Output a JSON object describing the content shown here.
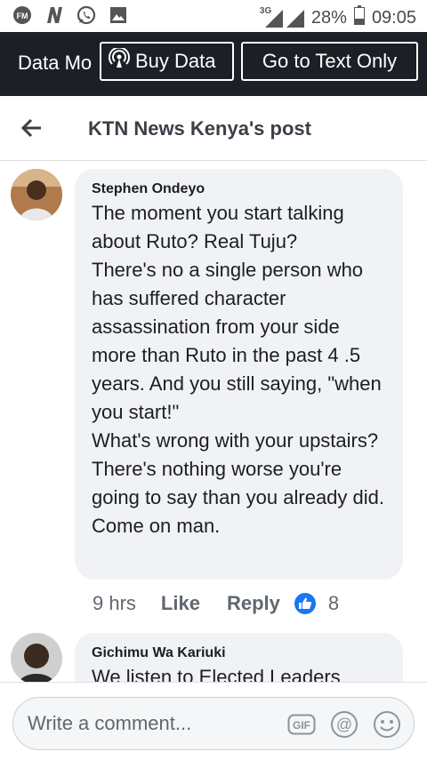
{
  "status_bar": {
    "icons": [
      "fm-radio-icon",
      "n-app-icon",
      "whatsapp-icon",
      "gallery-icon"
    ],
    "network": "3G",
    "battery": "28%",
    "time": "09:05"
  },
  "banner": {
    "data_mode_label": "Data Mo",
    "buy_data_label": "Buy Data",
    "text_only_label": "Go to Text Only"
  },
  "header": {
    "title": "KTN News Kenya's post"
  },
  "comments": [
    {
      "author": "Stephen Ondeyo",
      "text": "The moment you start talking about Ruto? Real Tuju?\nThere's no a single person who has suffered character assassination from your side more than Ruto in the past 4 .5 years. And you still saying, \"when you start!\"\nWhat's wrong with your upstairs?\nThere's nothing worse you're going to say than you already did. Come on man.",
      "time": "9 hrs",
      "like_label": "Like",
      "reply_label": "Reply",
      "reaction_icon": "like-reaction-icon",
      "reaction_count": "8"
    },
    {
      "author": "Gichimu Wa Kariuki",
      "text": "We listen to Elected Leaders"
    }
  ],
  "composer": {
    "placeholder": "Write a comment...",
    "gif_label": "GIF",
    "icons": [
      "gif-icon",
      "mention-icon",
      "emoji-icon"
    ]
  },
  "colors": {
    "banner_bg": "#1c2026",
    "bubble_bg": "#f0f2f5",
    "like_blue": "#1877f2"
  }
}
